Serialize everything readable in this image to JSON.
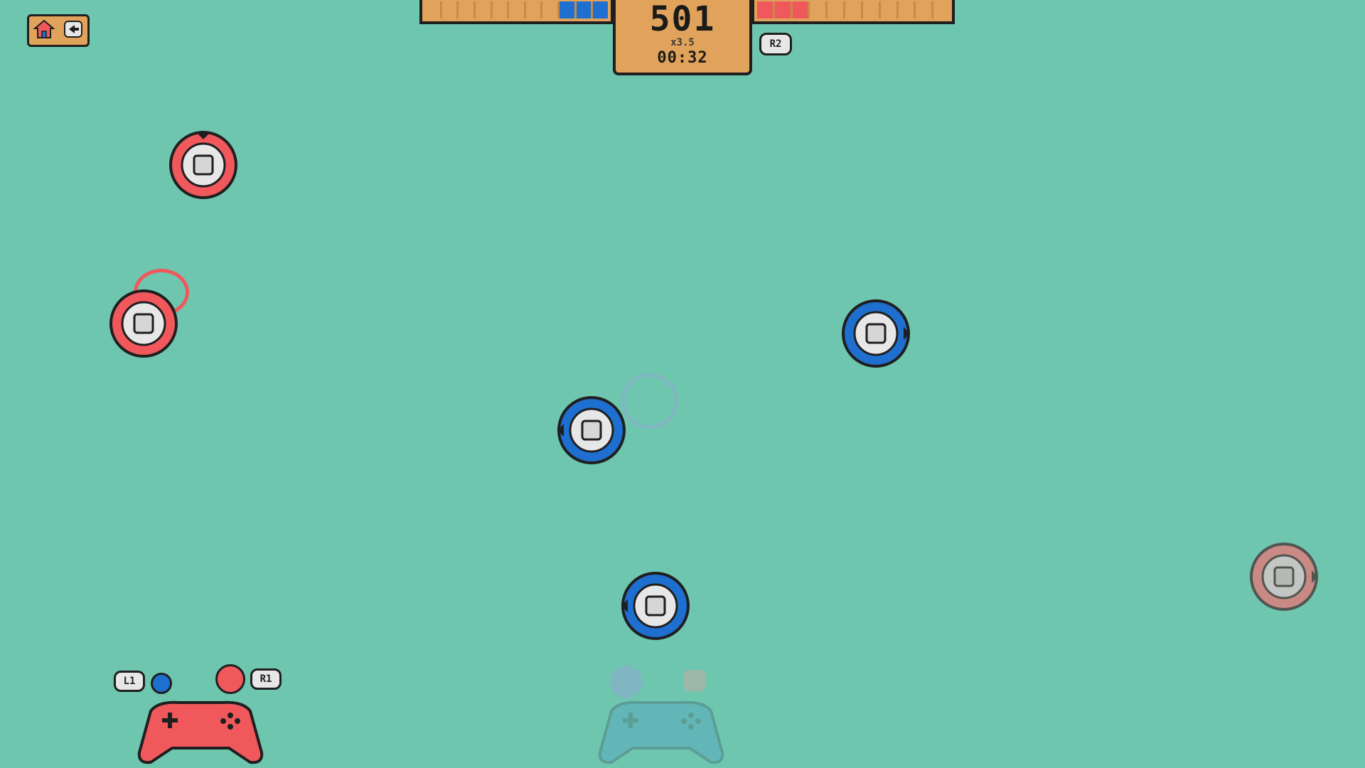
{
  "hud": {
    "score": "501",
    "multiplier": "x3.5",
    "timer": "00:32",
    "r2_label": "R2"
  },
  "controls": {
    "l1_label": "L1",
    "r1_label": "R1"
  },
  "icons": {
    "home": "home-icon",
    "back": "back-icon"
  },
  "colors": {
    "background": "#6fc6ae",
    "team_blue": "#1e6fcf",
    "team_red": "#f0585c",
    "hud_panel": "#e1a35b"
  },
  "teams": {
    "blue_progress_segments": 3,
    "red_progress_segments": 3,
    "total_segments": 11
  }
}
